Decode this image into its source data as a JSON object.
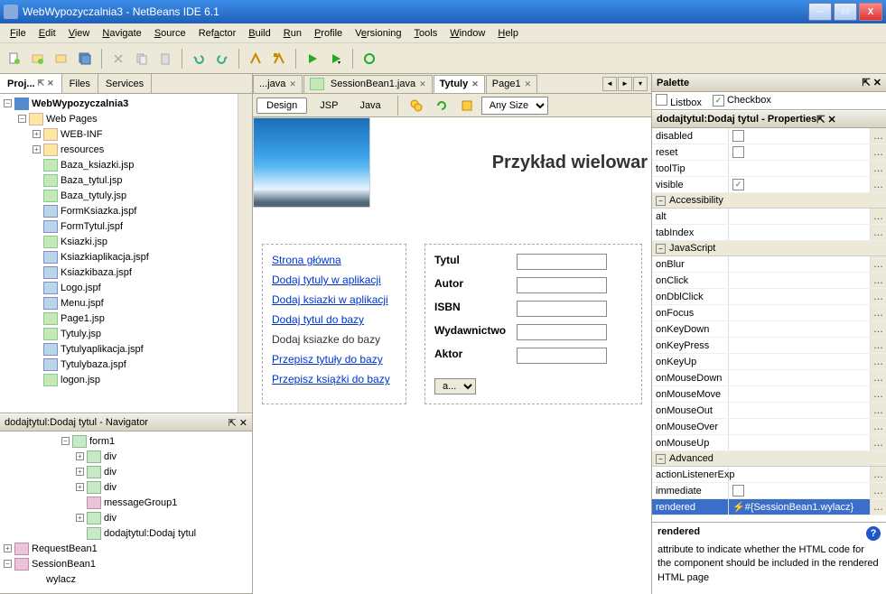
{
  "window": {
    "title": "WebWypozyczalnia3 - NetBeans IDE 6.1"
  },
  "menu": [
    "File",
    "Edit",
    "View",
    "Navigate",
    "Source",
    "Refactor",
    "Build",
    "Run",
    "Profile",
    "Versioning",
    "Tools",
    "Window",
    "Help"
  ],
  "leftTabs": [
    "Proj...",
    "Files",
    "Services"
  ],
  "projectTree": {
    "root": "WebWypozyczalnia3",
    "webPages": "Web Pages",
    "folders": [
      "WEB-INF",
      "resources"
    ],
    "files": [
      "Baza_ksiazki.jsp",
      "Baza_tytul.jsp",
      "Baza_tytuly.jsp",
      "FormKsiazka.jspf",
      "FormTytul.jspf",
      "Ksiazki.jsp",
      "Ksiazkiaplikacja.jspf",
      "Ksiazkibaza.jspf",
      "Logo.jspf",
      "Menu.jspf",
      "Page1.jsp",
      "Tytuly.jsp",
      "Tytulyaplikacja.jspf",
      "Tytulybaza.jspf",
      "logon.jsp"
    ]
  },
  "navigator": {
    "title": "dodajtytul:Dodaj tytul - Navigator",
    "items": [
      "form1",
      "div",
      "div",
      "div",
      "messageGroup1",
      "div",
      "dodajtytul:Dodaj tytul"
    ],
    "beans": [
      "RequestBean1",
      "SessionBean1",
      "wylacz"
    ]
  },
  "editorTabs": [
    "...java",
    "SessionBean1.java",
    "Tytuly",
    "Page1"
  ],
  "activeEditorTab": "Tytuly",
  "editorSubTabs": [
    "Design",
    "JSP",
    "Java"
  ],
  "sizeSelector": "Any Size",
  "canvas": {
    "pageTitle": "Przykład wielowar",
    "navLinks": [
      "Strona główna",
      "Dodaj tytuly w aplikacji",
      "Dodaj ksiazki w aplikacji",
      "Dodaj tytul do bazy",
      "Dodaj ksiazke do bazy",
      "Przepisz tytuły do bazy",
      "Przepisz książki do bazy"
    ],
    "navPlain": "Dodaj ksiazke do bazy",
    "formLabels": [
      "Tytul",
      "Autor",
      "ISBN",
      "Wydawnictwo",
      "Aktor"
    ],
    "selectLabel": "a..."
  },
  "paletteTitle": "Palette",
  "paletteItems": [
    "Listbox",
    "Checkbox"
  ],
  "propertiesTitle": "dodajtytul:Dodaj tytul - Properties",
  "properties": {
    "basic": [
      {
        "name": "disabled",
        "val": "",
        "check": false
      },
      {
        "name": "reset",
        "val": "",
        "check": false
      },
      {
        "name": "toolTip",
        "val": ""
      },
      {
        "name": "visible",
        "val": "",
        "check": true
      }
    ],
    "groups": [
      "Accessibility",
      "JavaScript",
      "Advanced"
    ],
    "accessibility": [
      {
        "name": "alt",
        "val": ""
      },
      {
        "name": "tabIndex",
        "val": ""
      }
    ],
    "javascript": [
      {
        "name": "onBlur",
        "val": ""
      },
      {
        "name": "onClick",
        "val": ""
      },
      {
        "name": "onDblClick",
        "val": ""
      },
      {
        "name": "onFocus",
        "val": ""
      },
      {
        "name": "onKeyDown",
        "val": ""
      },
      {
        "name": "onKeyPress",
        "val": ""
      },
      {
        "name": "onKeyUp",
        "val": ""
      },
      {
        "name": "onMouseDown",
        "val": ""
      },
      {
        "name": "onMouseMove",
        "val": ""
      },
      {
        "name": "onMouseOut",
        "val": ""
      },
      {
        "name": "onMouseOver",
        "val": ""
      },
      {
        "name": "onMouseUp",
        "val": ""
      }
    ],
    "advanced": [
      {
        "name": "actionListenerExp",
        "val": ""
      },
      {
        "name": "immediate",
        "val": "",
        "check": false
      },
      {
        "name": "rendered",
        "val": "#{SessionBean1.wylacz}",
        "selected": true
      }
    ]
  },
  "help": {
    "title": "rendered",
    "text": "attribute to indicate whether the HTML code for the component should be included in the rendered HTML page"
  }
}
